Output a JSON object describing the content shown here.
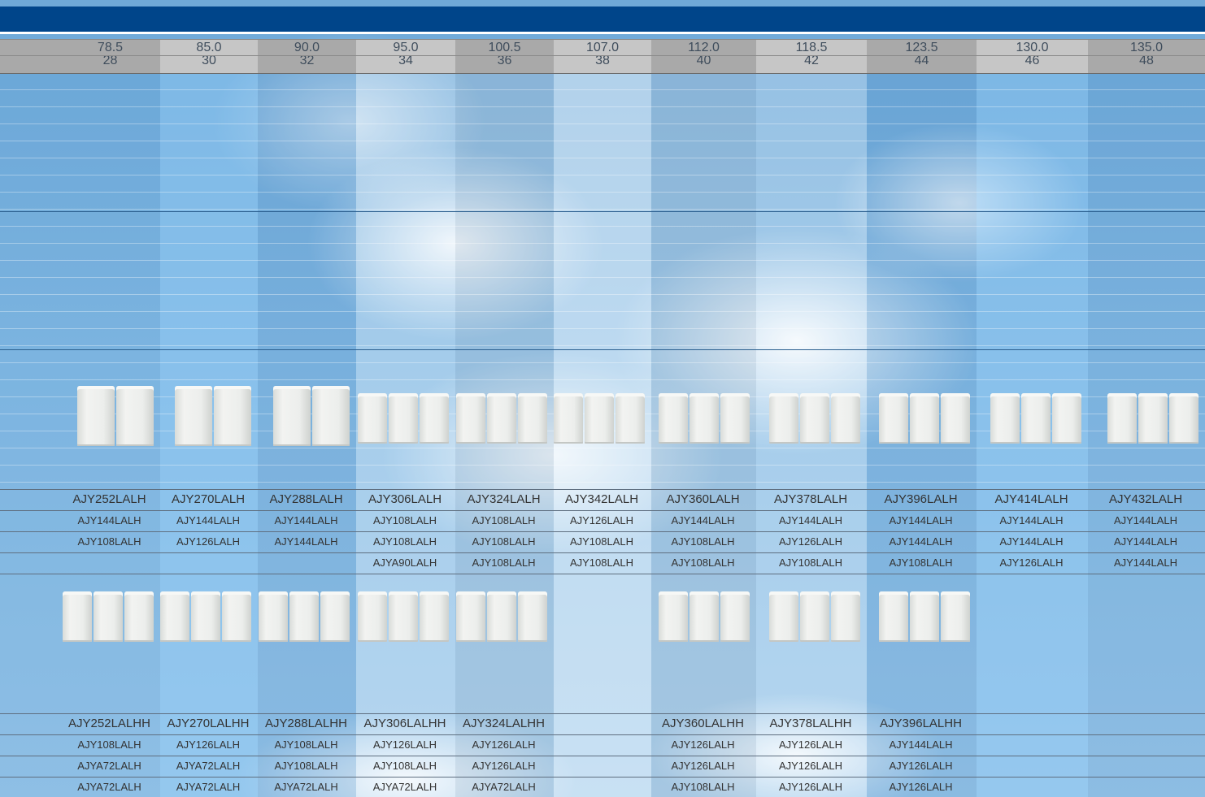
{
  "header": {
    "capacities": [
      "78.5",
      "85.0",
      "90.0",
      "95.0",
      "100.5",
      "107.0",
      "112.0",
      "118.5",
      "123.5",
      "130.0",
      "135.0"
    ],
    "hp": [
      "28",
      "30",
      "32",
      "34",
      "36",
      "38",
      "40",
      "42",
      "44",
      "46",
      "48"
    ]
  },
  "standard": {
    "models": [
      "AJY252LALH",
      "AJY270LALH",
      "AJY288LALH",
      "AJY306LALH",
      "AJY324LALH",
      "AJY342LALH",
      "AJY360LALH",
      "AJY378LALH",
      "AJY396LALH",
      "AJY414LALH",
      "AJY432LALH"
    ],
    "combo_row1": [
      "AJY144LALH",
      "AJY144LALH",
      "AJY144LALH",
      "AJY108LALH",
      "AJY108LALH",
      "AJY126LALH",
      "AJY144LALH",
      "AJY144LALH",
      "AJY144LALH",
      "AJY144LALH",
      "AJY144LALH"
    ],
    "combo_row2": [
      "AJY108LALH",
      "AJY126LALH",
      "AJY144LALH",
      "AJY108LALH",
      "AJY108LALH",
      "AJY108LALH",
      "AJY108LALH",
      "AJY126LALH",
      "AJY144LALH",
      "AJY144LALH",
      "AJY144LALH"
    ],
    "combo_row3": [
      "",
      "",
      "",
      "AJYA90LALH",
      "AJY108LALH",
      "AJY108LALH",
      "AJY108LALH",
      "AJY108LALH",
      "AJY108LALH",
      "AJY126LALH",
      "AJY144LALH"
    ]
  },
  "high_efficiency": {
    "models": [
      "AJY252LALHH",
      "AJY270LALHH",
      "AJY288LALHH",
      "AJY306LALHH",
      "AJY324LALHH",
      "",
      "AJY360LALHH",
      "AJY378LALHH",
      "AJY396LALHH",
      "",
      ""
    ],
    "combo_row1": [
      "AJY108LALH",
      "AJY126LALH",
      "AJY108LALH",
      "AJY126LALH",
      "AJY126LALH",
      "",
      "AJY126LALH",
      "AJY126LALH",
      "AJY144LALH",
      "",
      ""
    ],
    "combo_row2": [
      "AJYA72LALH",
      "AJYA72LALH",
      "AJY108LALH",
      "AJY108LALH",
      "AJY126LALH",
      "",
      "AJY126LALH",
      "AJY126LALH",
      "AJY126LALH",
      "",
      ""
    ],
    "combo_row3": [
      "AJYA72LALH",
      "AJYA72LALH",
      "AJYA72LALH",
      "AJYA72LALH",
      "AJYA72LALH",
      "",
      "AJY108LALH",
      "AJY126LALH",
      "AJY126LALH",
      "",
      ""
    ]
  },
  "colors": {
    "title_bar": "#00458a",
    "text": "#333333"
  }
}
